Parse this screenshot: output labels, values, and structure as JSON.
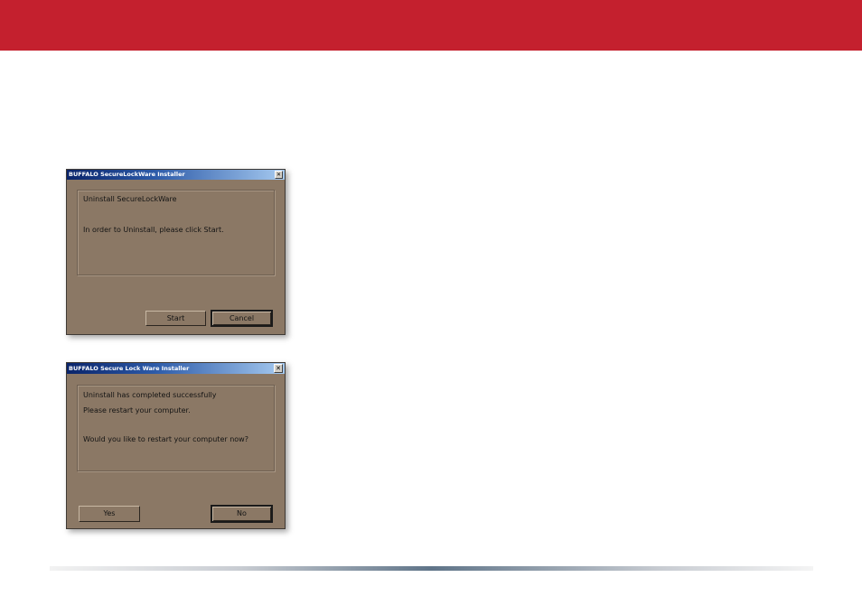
{
  "dialog1": {
    "title": "BUFFALO SecureLockWare Installer",
    "close_glyph": "✕",
    "heading": "Uninstall SecureLockWare",
    "message": "In order to Uninstall, please click Start.",
    "start_label": "Start",
    "cancel_label": "Cancel"
  },
  "dialog2": {
    "title": "BUFFALO Secure Lock Ware Installer",
    "close_glyph": "✕",
    "line1": "Uninstall has completed successfully",
    "line2": "Please restart your computer.",
    "line3": "Would you like to restart your computer now?",
    "yes_label": "Yes",
    "no_label": "No"
  },
  "colors": {
    "header": "#c4202e",
    "dialog_bg": "#8b7865",
    "titlebar_start": "#0a246a",
    "titlebar_end": "#a6caf0"
  }
}
